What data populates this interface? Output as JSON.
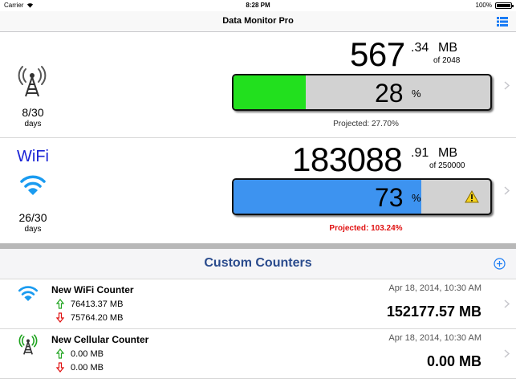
{
  "status_bar": {
    "carrier": "Carrier",
    "time": "8:28 PM",
    "battery": "100%"
  },
  "nav": {
    "title": "Data Monitor Pro",
    "menu_icon": "list-icon"
  },
  "cellular": {
    "icon": "cell-tower-icon",
    "days_count": "8/30",
    "days_label": "days",
    "amount_main": "567",
    "amount_decimal": ".34",
    "unit": "MB",
    "of_label": "of 2048",
    "percent": "28",
    "percent_sign": "%",
    "fill_fraction": 0.28,
    "fill_color": "#22e01e",
    "projected": "Projected: 27.70%"
  },
  "wifi": {
    "label": "WiFi",
    "icon": "wifi-icon",
    "days_count": "26/30",
    "days_label": "days",
    "amount_main": "183088",
    "amount_decimal": ".91",
    "unit": "MB",
    "of_label": "of 250000",
    "percent": "73",
    "percent_sign": "%",
    "fill_fraction": 0.73,
    "fill_color": "#3d93f0",
    "warning_icon": "warning-icon",
    "projected": "Projected: 103.24%"
  },
  "custom_counters": {
    "title": "Custom Counters",
    "add_icon": "add-circle-icon",
    "items": [
      {
        "icon": "wifi-icon",
        "name": "New WiFi Counter",
        "upload": "76413.37 MB",
        "download": "75764.20 MB",
        "date": "Apr 18, 2014, 10:30 AM",
        "total": "152177.57 MB"
      },
      {
        "icon": "cell-tower-icon",
        "name": "New Cellular Counter",
        "upload": "0.00 MB",
        "download": "0.00 MB",
        "date": "Apr 18, 2014, 10:30 AM",
        "total": "0.00 MB"
      }
    ]
  },
  "colors": {
    "accent": "#1a7cf5",
    "wifi_label": "#1b24d6",
    "section_title": "#2a4b8d",
    "alert": "#e01010",
    "upload_arrow": "#1ea31e",
    "download_arrow": "#e01010"
  }
}
